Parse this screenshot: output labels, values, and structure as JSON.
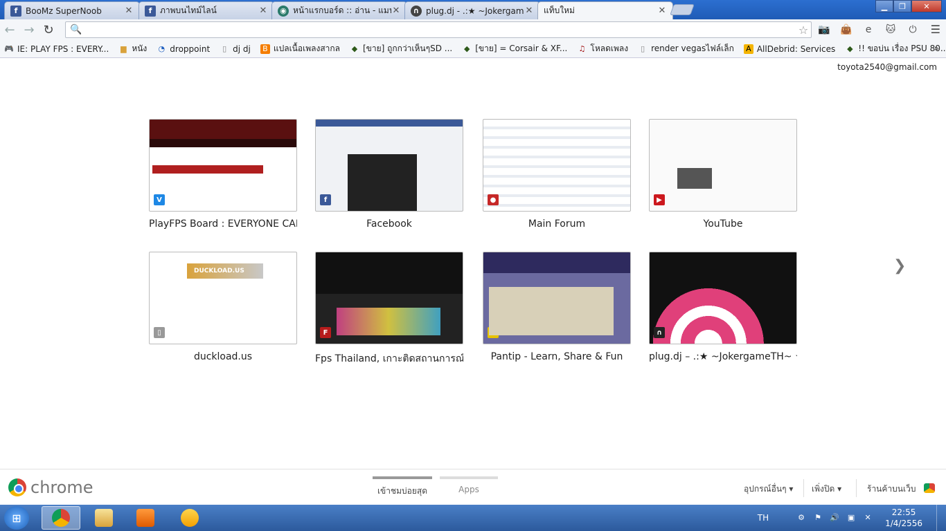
{
  "window": {
    "controls": {
      "minimize": "▁",
      "maximize": "❐",
      "close": "✕"
    }
  },
  "tabs": [
    {
      "title": "BooMz SuperNoob",
      "icon": "facebook-icon",
      "close": "✕"
    },
    {
      "title": "ภาพบนไทม์ไลน์",
      "icon": "facebook-icon",
      "close": "✕"
    },
    {
      "title": "หน้าแรกบอร์ด :: อ่าน - แมนฯ",
      "icon": "globe-icon",
      "close": "✕"
    },
    {
      "title": "plug.dj - .:★ ~Jokergame",
      "icon": "headphones-icon",
      "close": "✕"
    },
    {
      "title": "แท็บใหม่",
      "icon": "",
      "close": "✕"
    }
  ],
  "toolbar": {
    "back": "←",
    "forward": "→",
    "reload": "↻",
    "search_icon": "🔍",
    "address_value": "",
    "star": "☆",
    "menu": "☰"
  },
  "extensions": [
    "camera-icon",
    "bag-icon",
    "ie-icon",
    "cat-icon",
    "power-icon"
  ],
  "bookmarks": [
    {
      "label": "IE: PLAY FPS : EVERY...",
      "icon": "controller-icon"
    },
    {
      "label": "หนัง",
      "icon": "folder-icon"
    },
    {
      "label": "droppoint",
      "icon": "dp-icon"
    },
    {
      "label": "dj dj",
      "icon": "page-icon"
    },
    {
      "label": "แปลเนื้อเพลงสากล",
      "icon": "blogger-icon"
    },
    {
      "label": "[ขาย] ถูกกว่าเห็นๆSD ...",
      "icon": "diamond-icon"
    },
    {
      "label": "[ขาย] = Corsair & XF...",
      "icon": "diamond-icon"
    },
    {
      "label": "โหลดเพลง",
      "icon": "music-icon"
    },
    {
      "label": "render vegasไฟล์เล็ก",
      "icon": "page-icon"
    },
    {
      "label": "AllDebrid: Services",
      "icon": "alldebrid-icon"
    },
    {
      "label": "!! ขอบ่น เรื่อง PSU 80...",
      "icon": "diamond-icon"
    }
  ],
  "bookmarks_more": "»",
  "account": "toyota2540@gmail.com",
  "most_visited": [
    {
      "label": "PlayFPS Board : EVERYONE CAN...",
      "theme": "t-playfps",
      "fav": "V",
      "favcolor": "#1e88e5"
    },
    {
      "label": "Facebook",
      "theme": "t-facebook",
      "fav": "f",
      "favcolor": "#3b5998"
    },
    {
      "label": "Main Forum",
      "theme": "t-forum",
      "fav": "●",
      "favcolor": "#c62828"
    },
    {
      "label": "YouTube",
      "theme": "t-youtube",
      "fav": "▶",
      "favcolor": "#cc181e"
    },
    {
      "label": "duckload.us",
      "theme": "t-duck",
      "fav": "▯",
      "favcolor": "#999999"
    },
    {
      "label": "Fps Thailand, เกาะติดสถานการณ์แ...",
      "theme": "t-fps",
      "fav": "F",
      "favcolor": "#b71c1c"
    },
    {
      "label": "Pantip - Learn, Share & Fun",
      "theme": "t-pantip",
      "fav": "☻",
      "favcolor": "#e6c200"
    },
    {
      "label": "plug.dj – .:★ ~JokergameTH~ ★:.",
      "theme": "t-plug",
      "fav": "∩",
      "favcolor": "#222222"
    }
  ],
  "pager_next": "❯",
  "footer": {
    "brand": "chrome",
    "tabs": [
      {
        "label": "เข้าชมบ่อยสุด",
        "active": true
      },
      {
        "label": "Apps",
        "active": false
      }
    ],
    "other_devices": "อุปกรณ์อื่นๆ ▾",
    "recently_closed": "เพิ่งปิด ▾",
    "web_store": "ร้านค้าบนเว็บ"
  },
  "taskbar": {
    "start": "⊞",
    "apps": [
      "chrome",
      "explorer",
      "media-player",
      "app-x"
    ],
    "language": "TH",
    "time": "22:55",
    "date": "1/4/2556"
  }
}
